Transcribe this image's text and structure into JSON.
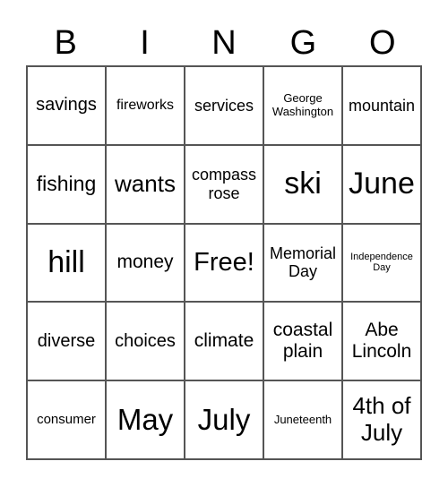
{
  "header": {
    "letters": [
      "B",
      "I",
      "N",
      "G",
      "O"
    ]
  },
  "grid": {
    "rows": [
      [
        "savings",
        "fireworks",
        "services",
        "George Washington",
        "mountain"
      ],
      [
        "fishing",
        "wants",
        "compass rose",
        "ski",
        "June"
      ],
      [
        "hill",
        "money",
        "Free!",
        "Memorial Day",
        "Independence Day"
      ],
      [
        "diverse",
        "choices",
        "climate",
        "coastal plain",
        "Abe Lincoln"
      ],
      [
        "consumer",
        "May",
        "July",
        "Juneteenth",
        "4th of July"
      ]
    ]
  }
}
